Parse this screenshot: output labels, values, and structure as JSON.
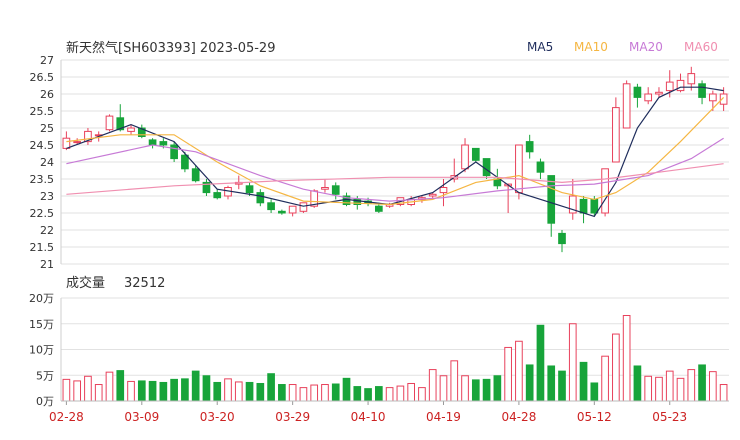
{
  "header": {
    "title": "新天然气[SH603393] 2023-05-29",
    "legend": [
      {
        "label": "MA5",
        "color": "#1f2d5c"
      },
      {
        "label": "MA10",
        "color": "#f5b642"
      },
      {
        "label": "MA20",
        "color": "#c77ad6"
      },
      {
        "label": "MA60",
        "color": "#f08fb0"
      }
    ]
  },
  "volume_panel": {
    "label": "成交量",
    "value": "32512"
  },
  "colors": {
    "up": "#e8415b",
    "down": "#17a43a",
    "grid": "#e2e2e2"
  },
  "chart_data": [
    {
      "type": "candlestick",
      "ylim": [
        21,
        27
      ],
      "y_ticks": [
        "21",
        "21.5",
        "22",
        "22.5",
        "23",
        "23.5",
        "24",
        "24.5",
        "25",
        "25.5",
        "26",
        "26.5",
        "27"
      ],
      "x_ticks": [
        {
          "label": "02-28",
          "index": 0
        },
        {
          "label": "03-09",
          "index": 7
        },
        {
          "label": "03-20",
          "index": 14
        },
        {
          "label": "03-29",
          "index": 21
        },
        {
          "label": "04-10",
          "index": 28
        },
        {
          "label": "04-19",
          "index": 35
        },
        {
          "label": "04-28",
          "index": 42
        },
        {
          "label": "05-12",
          "index": 49
        },
        {
          "label": "05-23",
          "index": 56
        }
      ],
      "candles": [
        [
          24.4,
          24.7,
          24.35,
          24.9
        ],
        [
          24.6,
          24.6,
          24.5,
          24.7
        ],
        [
          24.6,
          24.9,
          24.5,
          25.0
        ],
        [
          24.8,
          24.8,
          24.6,
          24.9
        ],
        [
          24.95,
          25.35,
          24.9,
          25.4
        ],
        [
          25.3,
          24.95,
          24.9,
          25.7
        ],
        [
          24.9,
          25.0,
          24.8,
          25.1
        ],
        [
          25.0,
          24.75,
          24.7,
          25.1
        ],
        [
          24.65,
          24.5,
          24.4,
          24.7
        ],
        [
          24.6,
          24.5,
          24.4,
          24.7
        ],
        [
          24.5,
          24.1,
          24.0,
          24.6
        ],
        [
          24.2,
          23.8,
          23.7,
          24.3
        ],
        [
          23.8,
          23.45,
          23.4,
          23.9
        ],
        [
          23.4,
          23.1,
          23.0,
          23.5
        ],
        [
          23.1,
          22.95,
          22.9,
          23.2
        ],
        [
          23.0,
          23.25,
          22.9,
          23.3
        ],
        [
          23.35,
          23.4,
          23.2,
          23.6
        ],
        [
          23.3,
          23.1,
          23.0,
          23.4
        ],
        [
          23.1,
          22.8,
          22.7,
          23.2
        ],
        [
          22.8,
          22.6,
          22.5,
          22.9
        ],
        [
          22.55,
          22.5,
          22.45,
          22.6
        ],
        [
          22.5,
          22.7,
          22.4,
          22.7
        ],
        [
          22.55,
          22.8,
          22.5,
          22.8
        ],
        [
          22.7,
          23.15,
          22.65,
          23.2
        ],
        [
          23.2,
          23.25,
          23.1,
          23.5
        ],
        [
          23.3,
          23.05,
          22.9,
          23.4
        ],
        [
          23.0,
          22.75,
          22.7,
          23.1
        ],
        [
          22.9,
          22.75,
          22.6,
          23.0
        ],
        [
          22.85,
          22.8,
          22.7,
          22.95
        ],
        [
          22.7,
          22.55,
          22.5,
          22.8
        ],
        [
          22.7,
          22.75,
          22.65,
          22.8
        ],
        [
          22.75,
          22.95,
          22.7,
          22.95
        ],
        [
          22.75,
          22.9,
          22.7,
          23.0
        ],
        [
          22.9,
          22.95,
          22.8,
          23.0
        ],
        [
          23.0,
          23.05,
          22.9,
          23.1
        ],
        [
          23.1,
          23.25,
          22.7,
          23.5
        ],
        [
          23.5,
          23.6,
          23.4,
          24.1
        ],
        [
          23.8,
          24.5,
          23.7,
          24.7
        ],
        [
          24.4,
          24.05,
          24.0,
          24.4
        ],
        [
          24.1,
          23.6,
          23.5,
          24.1
        ],
        [
          23.5,
          23.3,
          23.2,
          23.8
        ],
        [
          23.3,
          23.35,
          22.5,
          23.3
        ],
        [
          23.1,
          24.5,
          22.9,
          24.5
        ],
        [
          24.6,
          24.3,
          24.1,
          24.8
        ],
        [
          24.0,
          23.7,
          23.5,
          24.1
        ],
        [
          23.6,
          22.2,
          21.8,
          23.6
        ],
        [
          21.9,
          21.6,
          21.35,
          22.0
        ],
        [
          22.5,
          23.0,
          22.3,
          23.5
        ],
        [
          22.9,
          22.5,
          22.2,
          23.0
        ],
        [
          22.9,
          22.5,
          22.4,
          23.0
        ],
        [
          22.5,
          23.8,
          22.4,
          23.8
        ],
        [
          24.0,
          25.6,
          24.0,
          25.9
        ],
        [
          25.0,
          26.3,
          25.0,
          26.4
        ],
        [
          26.2,
          25.9,
          25.6,
          26.3
        ],
        [
          25.8,
          26.0,
          25.7,
          26.2
        ],
        [
          26.0,
          26.05,
          25.9,
          26.2
        ],
        [
          26.1,
          26.35,
          25.9,
          26.7
        ],
        [
          26.1,
          26.4,
          26.05,
          26.6
        ],
        [
          26.3,
          26.6,
          26.1,
          26.8
        ],
        [
          26.3,
          25.9,
          25.7,
          26.4
        ],
        [
          25.8,
          26.0,
          25.5,
          26.1
        ],
        [
          25.7,
          26.0,
          25.5,
          26.2
        ]
      ],
      "ma": {
        "MA5": [
          [
            0,
            24.4
          ],
          [
            6,
            25.1
          ],
          [
            10,
            24.6
          ],
          [
            14,
            23.2
          ],
          [
            18,
            23.0
          ],
          [
            22,
            22.7
          ],
          [
            26,
            22.9
          ],
          [
            30,
            22.75
          ],
          [
            34,
            23.1
          ],
          [
            38,
            24.0
          ],
          [
            42,
            23.1
          ],
          [
            47,
            22.6
          ],
          [
            49,
            22.4
          ],
          [
            51,
            23.4
          ],
          [
            53,
            25.0
          ],
          [
            55,
            25.9
          ],
          [
            57,
            26.2
          ],
          [
            59,
            26.2
          ],
          [
            61,
            26.1
          ]
        ],
        "MA10": [
          [
            0,
            24.6
          ],
          [
            5,
            24.8
          ],
          [
            10,
            24.8
          ],
          [
            14,
            24.0
          ],
          [
            18,
            23.3
          ],
          [
            22,
            22.85
          ],
          [
            26,
            22.8
          ],
          [
            30,
            22.75
          ],
          [
            34,
            22.9
          ],
          [
            38,
            23.4
          ],
          [
            42,
            23.6
          ],
          [
            46,
            23.1
          ],
          [
            49,
            22.9
          ],
          [
            51,
            23.1
          ],
          [
            54,
            23.7
          ],
          [
            57,
            24.6
          ],
          [
            61,
            25.9
          ]
        ],
        "MA20": [
          [
            0,
            23.95
          ],
          [
            8,
            24.5
          ],
          [
            12,
            24.3
          ],
          [
            18,
            23.6
          ],
          [
            22,
            23.2
          ],
          [
            26,
            22.95
          ],
          [
            30,
            22.85
          ],
          [
            35,
            22.95
          ],
          [
            40,
            23.15
          ],
          [
            45,
            23.3
          ],
          [
            49,
            23.35
          ],
          [
            54,
            23.6
          ],
          [
            58,
            24.1
          ],
          [
            61,
            24.7
          ]
        ],
        "MA60": [
          [
            0,
            23.05
          ],
          [
            10,
            23.3
          ],
          [
            20,
            23.45
          ],
          [
            30,
            23.55
          ],
          [
            40,
            23.55
          ],
          [
            46,
            23.4
          ],
          [
            50,
            23.5
          ],
          [
            55,
            23.7
          ],
          [
            61,
            23.95
          ]
        ]
      }
    },
    {
      "type": "bar",
      "ylim": [
        0,
        20
      ],
      "y_ticks": [
        "0万",
        "5万",
        "10万",
        "15万",
        "20万"
      ],
      "unit": "万",
      "values": [
        4.2,
        3.9,
        4.8,
        3.2,
        5.6,
        5.9,
        3.8,
        3.9,
        3.8,
        3.6,
        4.2,
        4.3,
        5.8,
        4.9,
        3.6,
        4.3,
        3.7,
        3.6,
        3.4,
        5.3,
        3.2,
        3.2,
        2.6,
        3.1,
        3.2,
        3.3,
        4.4,
        2.8,
        2.4,
        2.8,
        2.6,
        2.9,
        3.4,
        2.6,
        6.1,
        4.9,
        7.8,
        4.9,
        4.1,
        4.2,
        4.9,
        10.4,
        11.6,
        7.0,
        14.7,
        6.8,
        5.8,
        15.0,
        7.5,
        3.5,
        8.7,
        13.0,
        16.6,
        6.8,
        4.8,
        4.6,
        5.8,
        4.4,
        6.1,
        7.0,
        5.7,
        3.2
      ]
    }
  ]
}
